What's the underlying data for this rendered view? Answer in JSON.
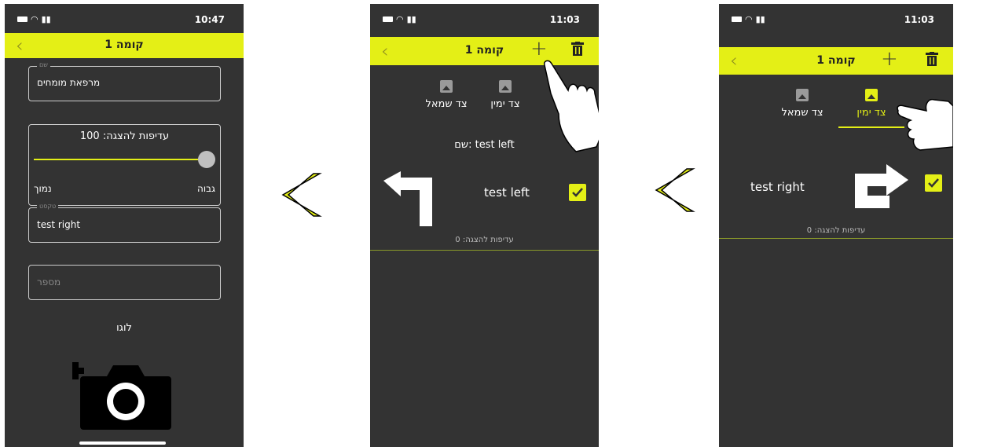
{
  "colors": {
    "accent": "#e4ef16",
    "background": "#333333",
    "text": "#ffffff"
  },
  "screen1": {
    "status": {
      "time": "10:47"
    },
    "navbar": {
      "back_icon": "chevron-left-icon",
      "title": "קומה 1"
    },
    "name_field": {
      "label": "שם",
      "value": "מרפאת מומחים"
    },
    "slider": {
      "title": "עדיפות להצגה: 100",
      "value_percent": 100,
      "low_label": "נמוך",
      "high_label": "גבוה"
    },
    "text_field": {
      "label": "טקסט",
      "value": "test right"
    },
    "number_field": {
      "placeholder": "מספר"
    },
    "logo": {
      "label": "לוגו",
      "icon": "add-camera-icon"
    }
  },
  "screen2": {
    "status": {
      "time": "11:03"
    },
    "navbar": {
      "back_icon": "chevron-left-icon",
      "title": "קומה 1",
      "add_icon": "plus-icon",
      "delete_icon": "trash-icon"
    },
    "tabs": [
      {
        "label": "צד ימין",
        "active": false
      },
      {
        "label": "צד שמאל",
        "active": false
      }
    ],
    "name_line": "שם: test left",
    "item": {
      "text": "test left",
      "checked": true,
      "arrow_icon": "arrow-turn-left-icon"
    },
    "priority": "עדיפות להצגה: 0"
  },
  "screen3": {
    "status": {
      "time": "11:03"
    },
    "navbar": {
      "back_icon": "chevron-left-icon",
      "title": "קומה 1",
      "add_icon": "plus-icon",
      "delete_icon": "trash-icon"
    },
    "tabs": [
      {
        "label": "צד ימין",
        "active": true
      },
      {
        "label": "צד שמאל",
        "active": false
      }
    ],
    "item": {
      "text": "test right",
      "checked": true,
      "arrow_icon": "arrow-u-turn-right-icon"
    },
    "priority": "עדיפות להצגה: 0"
  }
}
